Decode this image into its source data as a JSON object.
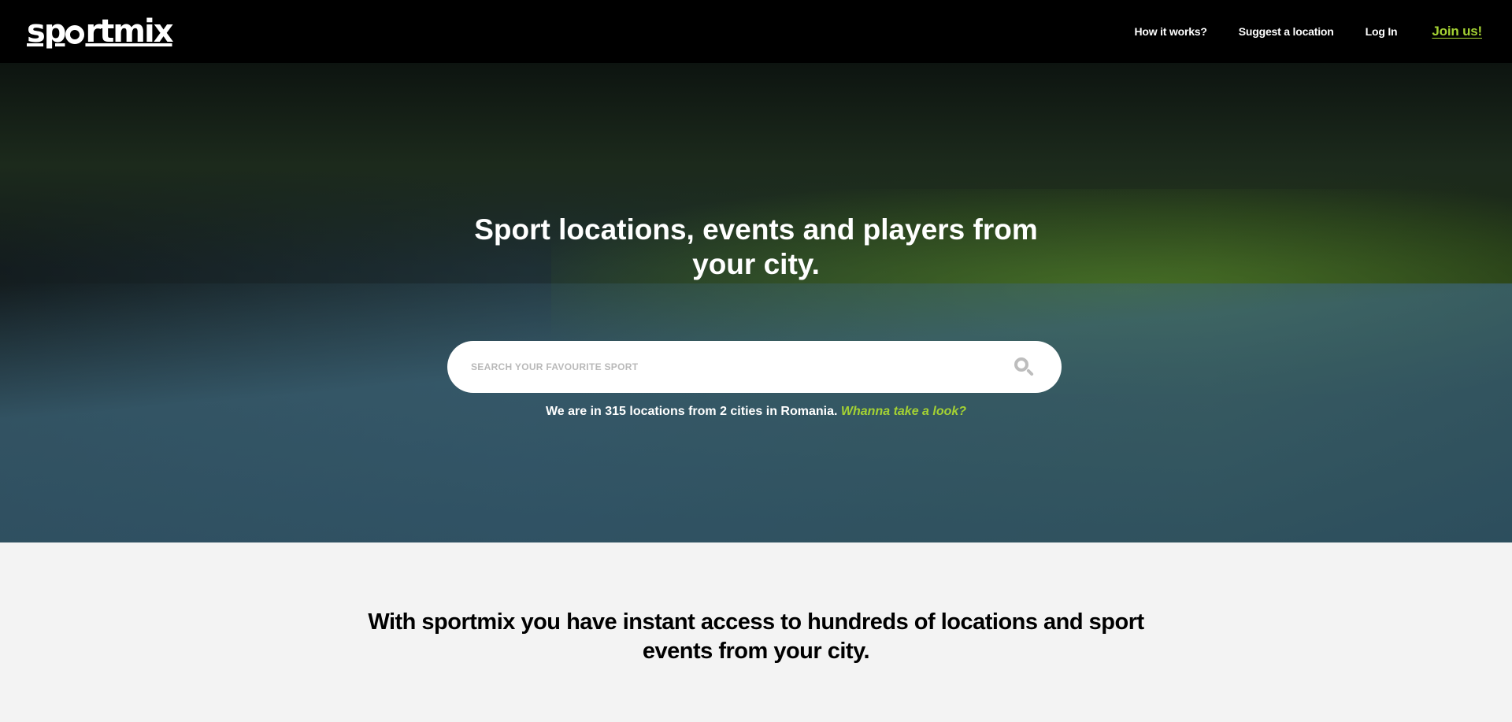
{
  "brand": {
    "logo_prefix": "sp",
    "logo_suffix": "rtmix"
  },
  "nav": {
    "how_it_works": "How it works?",
    "suggest_location": "Suggest a location",
    "log_in": "Log In",
    "join_us": "Join us!"
  },
  "hero": {
    "title": "Sport locations, events and players from your city.",
    "search_placeholder": "SEARCH YOUR FAVOURITE SPORT",
    "stats_prefix": "We are in 315 locations from  2 cities in Romania.",
    "stats_link": "Whanna take a look?"
  },
  "intro": {
    "text": "With sportmix you have instant access to hundreds of locations and sport events from your city."
  },
  "colors": {
    "accent": "#a4d233",
    "topbar": "#000000",
    "section_bg": "#f3f3f3"
  }
}
